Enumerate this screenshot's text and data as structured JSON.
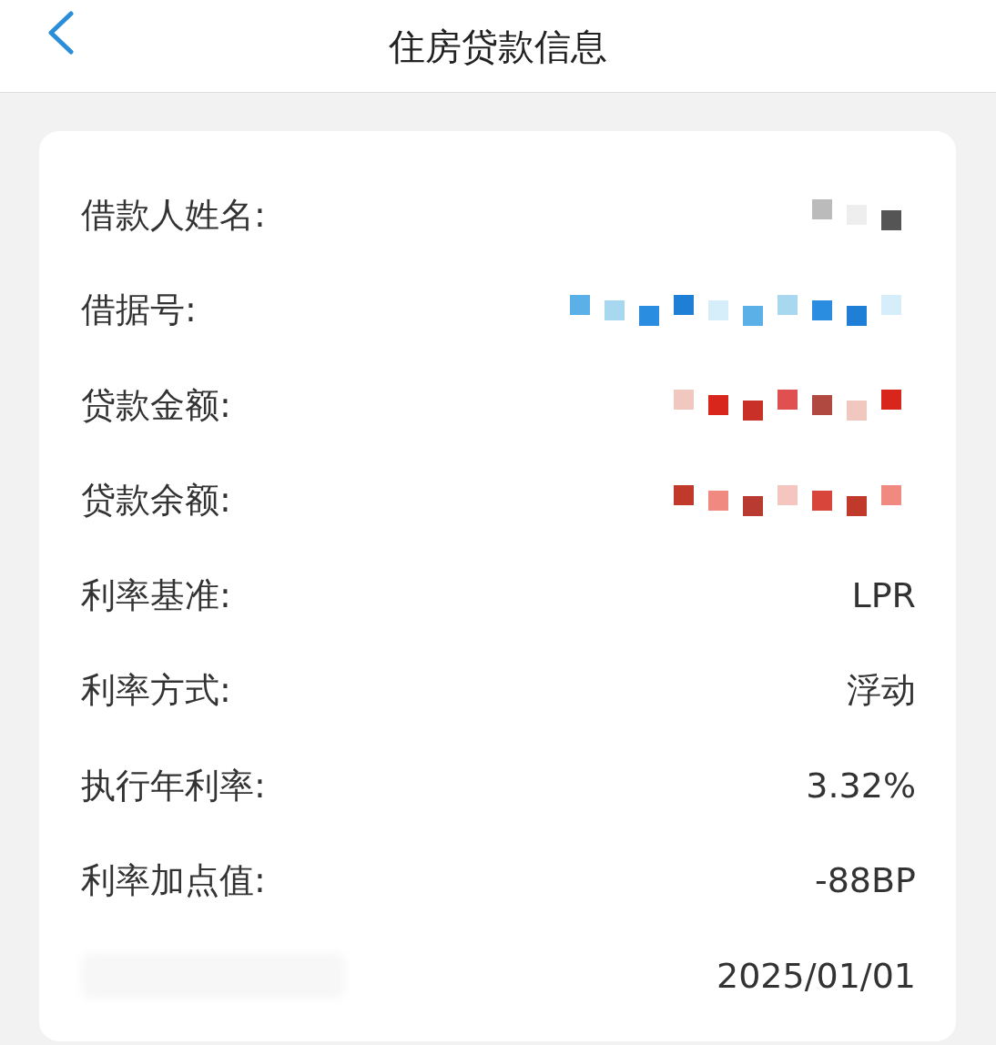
{
  "header": {
    "title": "住房贷款信息"
  },
  "rows": [
    {
      "label": "借款人姓名:",
      "label_hidden": false,
      "kind": "redacted"
    },
    {
      "label": "借据号:",
      "label_hidden": false,
      "kind": "redacted"
    },
    {
      "label": "贷款金额:",
      "label_hidden": false,
      "kind": "redacted"
    },
    {
      "label": "贷款余额:",
      "label_hidden": false,
      "kind": "redacted"
    },
    {
      "label": "利率基准:",
      "label_hidden": false,
      "kind": "text",
      "value": "LPR"
    },
    {
      "label": "利率方式:",
      "label_hidden": false,
      "kind": "text",
      "value": "浮动"
    },
    {
      "label": "执行年利率:",
      "label_hidden": false,
      "kind": "text",
      "value": "3.32%"
    },
    {
      "label": "利率加点值:",
      "label_hidden": false,
      "kind": "text",
      "value": "-88BP"
    },
    {
      "label_hidden": true,
      "kind": "text",
      "value": "2025/01/01"
    }
  ]
}
